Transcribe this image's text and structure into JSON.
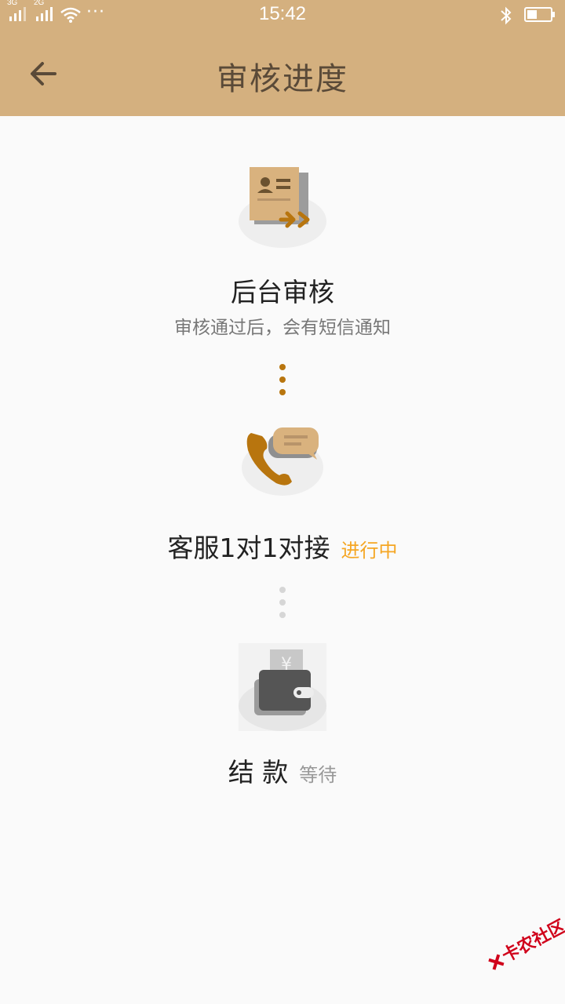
{
  "status_bar": {
    "sim1_label": "3G",
    "sim2_label": "2G",
    "more": "···",
    "time": "15:42"
  },
  "header": {
    "title": "审核进度"
  },
  "steps": [
    {
      "title": "后台审核",
      "description": "审核通过后，会有短信通知",
      "icon": "id-card-document-icon"
    },
    {
      "title": "客服1对1对接",
      "status": "进行中",
      "icon": "phone-chat-icon"
    },
    {
      "title": "结 款",
      "status": "等待",
      "icon": "wallet-icon"
    }
  ],
  "watermark": "卡农社区",
  "colors": {
    "header_bg": "#d4b07f",
    "accent": "#b8750e",
    "status_active": "#f5a623",
    "status_wait": "#999999"
  }
}
